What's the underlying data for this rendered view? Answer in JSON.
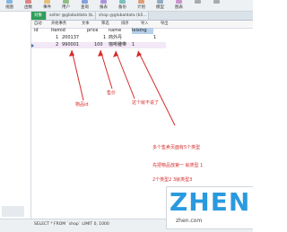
{
  "toolbar": {
    "items": [
      {
        "label": "视图",
        "icon": "view-icon",
        "color": "#6aa5d8"
      },
      {
        "label": "函数",
        "icon": "function-icon",
        "color": "#d86a6a"
      },
      {
        "label": "事件",
        "icon": "event-icon",
        "color": "#e3b35a"
      },
      {
        "label": "用户",
        "icon": "user-icon",
        "color": "#7cb06a"
      },
      {
        "label": "查询",
        "icon": "query-icon",
        "color": "#6a8cd8"
      },
      {
        "label": "报表",
        "icon": "report-icon",
        "color": "#9a7cd8"
      },
      {
        "label": "备份",
        "icon": "backup-icon",
        "color": "#5bb5b0"
      },
      {
        "label": "计划",
        "icon": "schedule-icon",
        "color": "#d88a5a"
      },
      {
        "label": "模型",
        "icon": "model-icon",
        "color": "#7a9ab5"
      },
      {
        "label": "图表",
        "icon": "chart-icon",
        "color": "#c57ac5"
      },
      {
        "label": "",
        "icon": "more-icon",
        "color": "#999999"
      },
      {
        "label": "",
        "icon": "more-icon",
        "color": "#999999"
      }
    ]
  },
  "tabs": [
    {
      "label": "对象"
    },
    {
      "label": "seller @globaldata (b..."
    },
    {
      "label": "shop @globaldata (b5..."
    }
  ],
  "subbar": {
    "items": [
      "自动",
      "开始事务",
      "文本",
      "筛选",
      "排序",
      "导入",
      "导出"
    ]
  },
  "grid": {
    "columns": [
      "id",
      "itemid",
      "price",
      "name",
      "leixing"
    ],
    "rows": [
      [
        "1",
        "200137",
        "1",
        "商外丹",
        "1"
      ],
      [
        "2",
        "990001",
        "100",
        "咖啡雕带",
        "1"
      ]
    ]
  },
  "annotations": {
    "item_id": "物品id",
    "price": "售价",
    "name": "这个就不说了",
    "note1": "多个售卖页面有5个类型",
    "note2": "先把物品放第一 就类型    1",
    "note3": "2个类型2    3就类型3"
  },
  "statusbar": {
    "query": "SELECT * FROM `shop` LIMIT 0, 1000",
    "tail": "SU"
  },
  "watermark": {
    "logo": "ZHEN",
    "sub": "zhen.com"
  }
}
